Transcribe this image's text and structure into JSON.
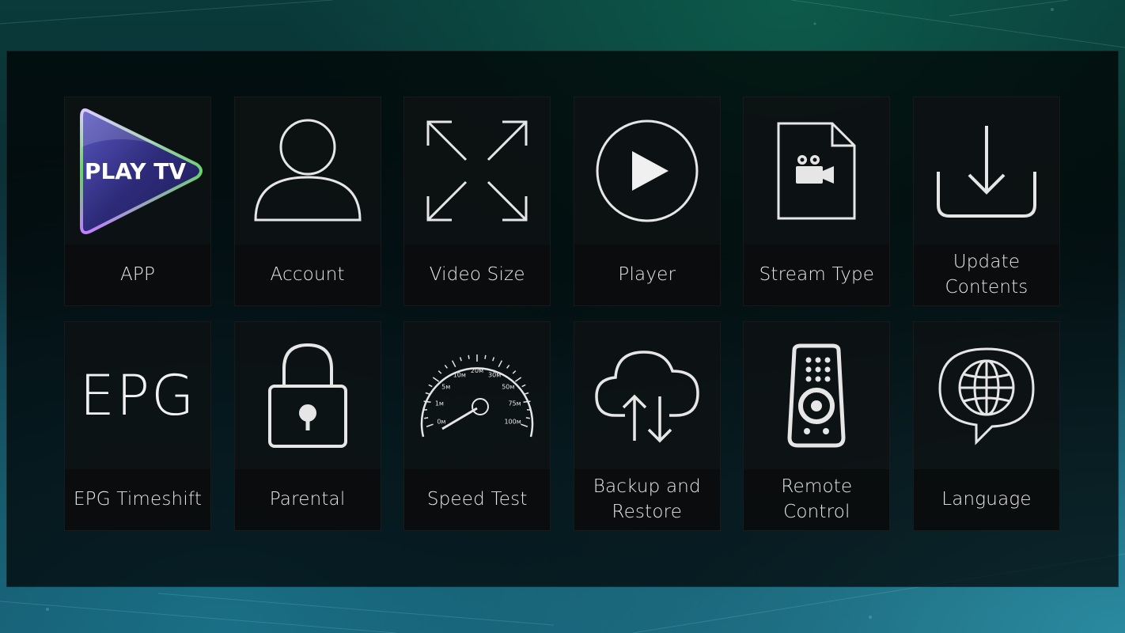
{
  "brand": {
    "logo_text": "PLAY TV",
    "accent_purple": "#3b3a8f",
    "accent_teal": "#1a6f86"
  },
  "menu": {
    "tiles": [
      {
        "label": "APP",
        "icon": "play-tv-logo-icon"
      },
      {
        "label": "Account",
        "icon": "user-icon"
      },
      {
        "label": "Video Size",
        "icon": "expand-arrows-icon"
      },
      {
        "label": "Player",
        "icon": "play-circle-icon"
      },
      {
        "label": "Stream Type",
        "icon": "video-file-icon"
      },
      {
        "label": "Update\nContents",
        "icon": "download-icon"
      },
      {
        "label": "EPG Timeshift",
        "icon": "epg-icon",
        "icon_text": "EPG"
      },
      {
        "label": "Parental",
        "icon": "lock-icon"
      },
      {
        "label": "Speed Test",
        "icon": "speedometer-icon",
        "gauge_labels": [
          "0м",
          "1м",
          "5м",
          "10м",
          "20м",
          "30м",
          "50м",
          "75м",
          "100м"
        ]
      },
      {
        "label": "Backup and\nRestore",
        "icon": "cloud-sync-icon"
      },
      {
        "label": "Remote\nControl",
        "icon": "remote-control-icon"
      },
      {
        "label": "Language",
        "icon": "globe-speech-icon"
      }
    ]
  }
}
